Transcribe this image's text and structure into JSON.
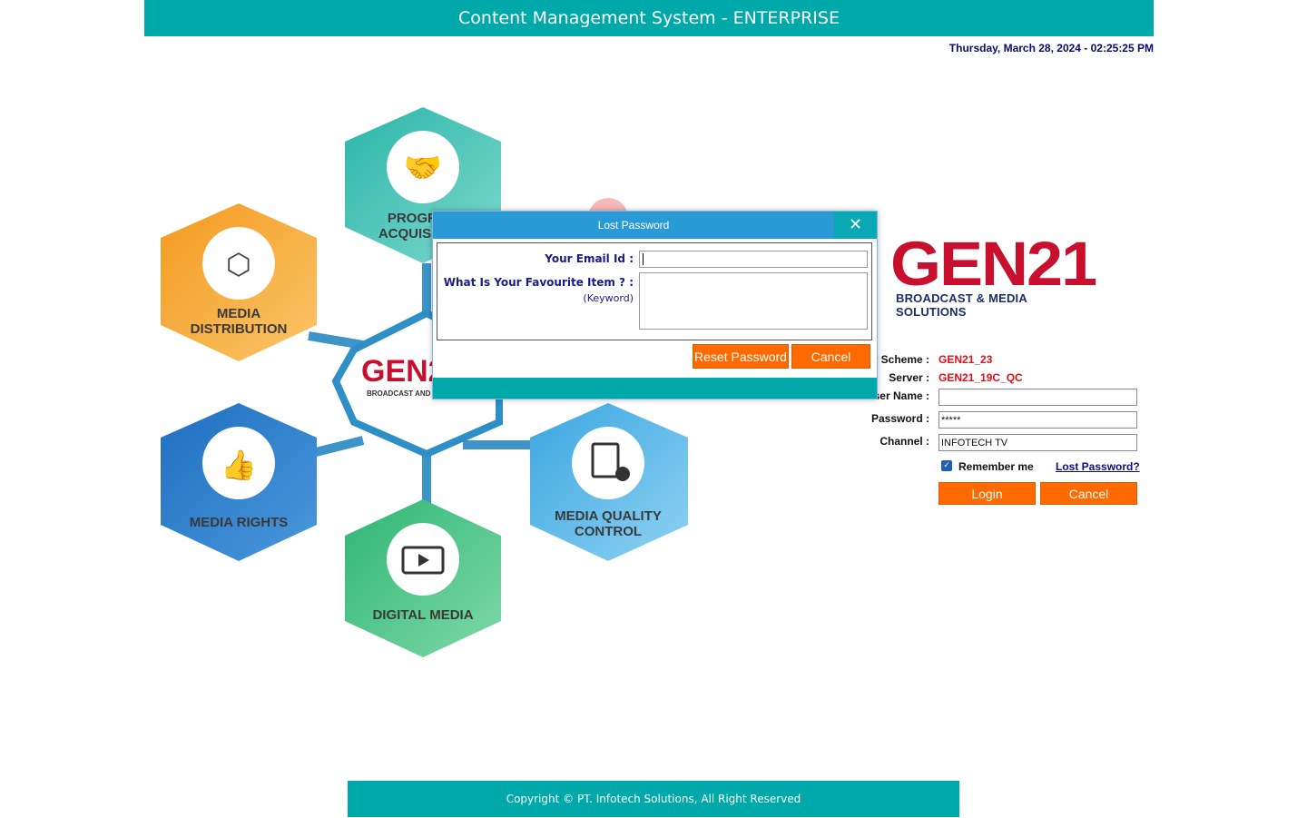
{
  "header": {
    "title": "Content Management System -  ENTERPRISE"
  },
  "datetime": "Thursday, March 28, 2024 - 02:25:25 PM",
  "graphic": {
    "center_logo": "GEN21",
    "center_tag": "BROADCAST AND MEDIA SOLUTIONS",
    "modules": [
      {
        "line1": "PROGRAM",
        "line2": "ACQUISITION",
        "color": "#2bb5a8",
        "icon": "handshake-icon"
      },
      {
        "line1": "MEDIA",
        "line2": "DISTRIBUTION",
        "color": "#f39a1f",
        "icon": "distribution-cube-icon"
      },
      {
        "line1": "MEDIA RIGHTS",
        "line2": "",
        "color": "#1f6fc0",
        "icon": "thumbs-up-icon"
      },
      {
        "line1": "DIGITAL MEDIA",
        "line2": "",
        "color": "#2fb673",
        "icon": "play-video-icon"
      },
      {
        "line1": "MEDIA QUALITY",
        "line2": "CONTROL",
        "color": "#3aa6e0",
        "icon": "quality-report-icon"
      }
    ]
  },
  "brand": {
    "name": "GEN21",
    "tagline": "BROADCAST & MEDIA SOLUTIONS",
    "color": "#c8102e"
  },
  "login": {
    "scheme_label": "User Scheme :",
    "scheme_value": "GEN21_23",
    "server_label": "Server :",
    "server_value": "GEN21_19C_QC",
    "username_label": "User Name :",
    "username_value": "",
    "password_label": "Password :",
    "password_value": "*****",
    "channel_label": "Channel :",
    "channel_value": "INFOTECH TV",
    "remember_label": "Remember me",
    "remember_checked": true,
    "lost_password_link": "Lost Password?",
    "login_button": "Login",
    "cancel_button": "Cancel"
  },
  "modal": {
    "title": "Lost Password",
    "email_label": "Your Email Id :",
    "email_value": "",
    "question_label": "What Is Your Favourite Item ? :",
    "question_hint": "(Keyword)",
    "reset_button": "Reset Password",
    "cancel_button": "Cancel"
  },
  "footer": {
    "copyright": "Copyright © PT. Infotech Solutions, All Right Reserved"
  },
  "colors": {
    "teal": "#00a9a9",
    "orange": "#ff6a00",
    "modal_blue": "#2a9ad6",
    "red_value": "#e0101a"
  }
}
